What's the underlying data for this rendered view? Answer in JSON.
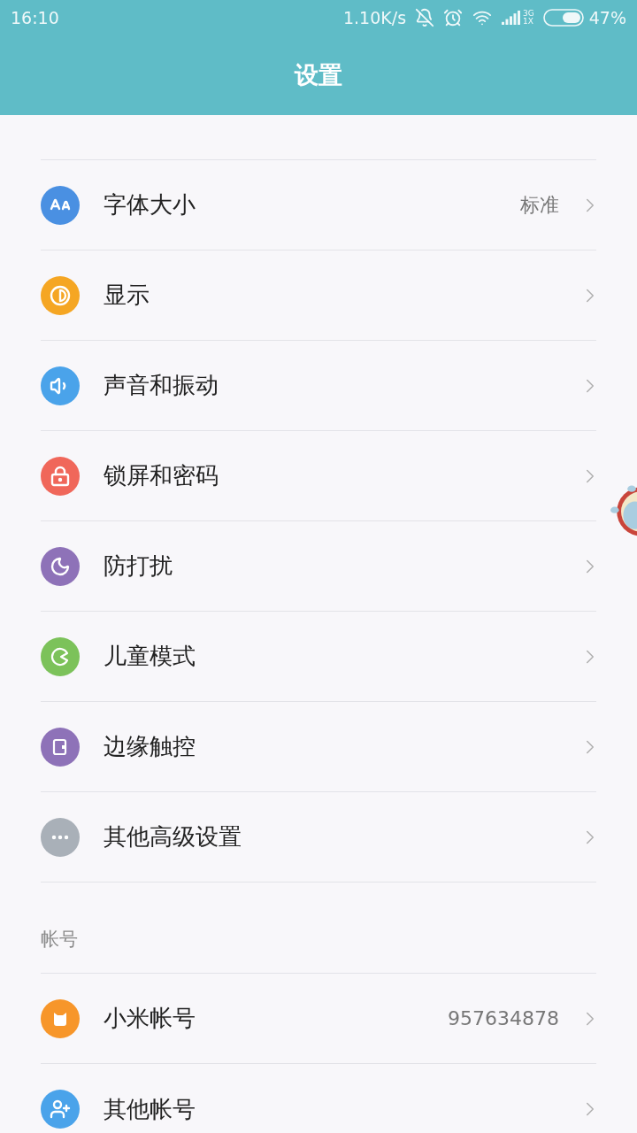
{
  "status_bar": {
    "time": "16:10",
    "speed": "1.10K/s",
    "network": [
      "3G",
      "1X"
    ],
    "battery": "47%"
  },
  "header": {
    "title": "设置"
  },
  "items": [
    {
      "label": "字体大小",
      "value": "标准",
      "color": "#4a90e2"
    },
    {
      "label": "显示",
      "color": "#f5a623"
    },
    {
      "label": "声音和振动",
      "color": "#4aa3ea"
    },
    {
      "label": "锁屏和密码",
      "color": "#f0675a"
    },
    {
      "label": "防打扰",
      "color": "#8e72b8"
    },
    {
      "label": "儿童模式",
      "color": "#7cc25a"
    },
    {
      "label": "边缘触控",
      "color": "#8e72b8"
    },
    {
      "label": "其他高级设置",
      "color": "#a9b0b8"
    }
  ],
  "account_section": {
    "title": "帐号",
    "items": [
      {
        "label": "小米帐号",
        "value": "957634878",
        "color": "#f7962a"
      },
      {
        "label": "其他帐号",
        "color": "#4aa3ea"
      }
    ]
  }
}
